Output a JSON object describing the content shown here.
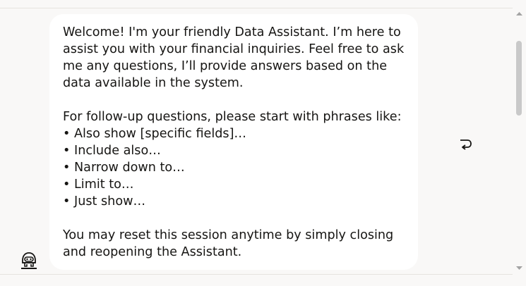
{
  "chat": {
    "message": {
      "intro": "Welcome! I'm your friendly Data Assistant. I’m here to assist you with your financial inquiries. Feel free to ask me any questions, I’ll provide answers based on the data available in the system.",
      "followup_heading": "For follow-up questions, please start with phrases like:",
      "phrases": [
        "Also show [specific fields]…",
        "Include also…",
        "Narrow down to…",
        "Limit to…",
        "Just show…"
      ],
      "reset_note": "You may reset this session anytime by simply closing and reopening the Assistant."
    },
    "bot_avatar_icon": "robot-avatar-icon",
    "reply_icon": "reply-arrow-icon"
  },
  "colors": {
    "background": "#f9f8f7",
    "bubble": "#ffffff",
    "text": "#161513",
    "scroll_thumb": "#c9c9c9"
  }
}
